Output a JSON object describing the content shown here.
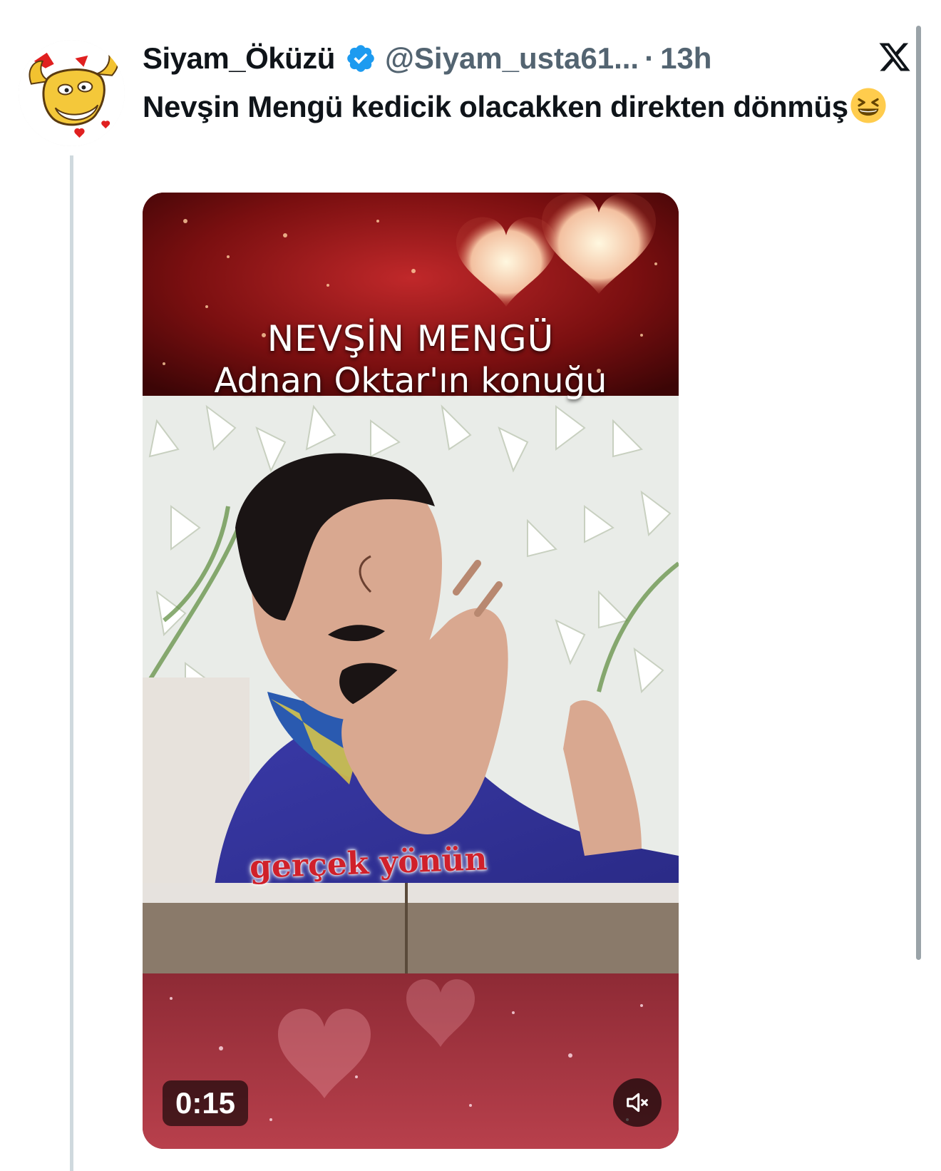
{
  "tweet": {
    "display_name": "Siyam_Öküzü",
    "handle": "@Siyam_usta61...",
    "separator": "·",
    "time": "13h",
    "text": "Nevşin Mengü kedicik olacakken direkten dönmüş",
    "emoji": "grinning-squinting-face"
  },
  "media": {
    "caption_line1": "NEVŞİN MENGÜ",
    "caption_line2": "Adnan Oktar'ın konuğu",
    "subtitle": "gerçek yönün",
    "duration": "0:15",
    "muted": true
  },
  "colors": {
    "verified": "#1d9bf0",
    "handle": "#536471",
    "thread_line": "#cfd9de",
    "subtitle": "#d0202a"
  }
}
